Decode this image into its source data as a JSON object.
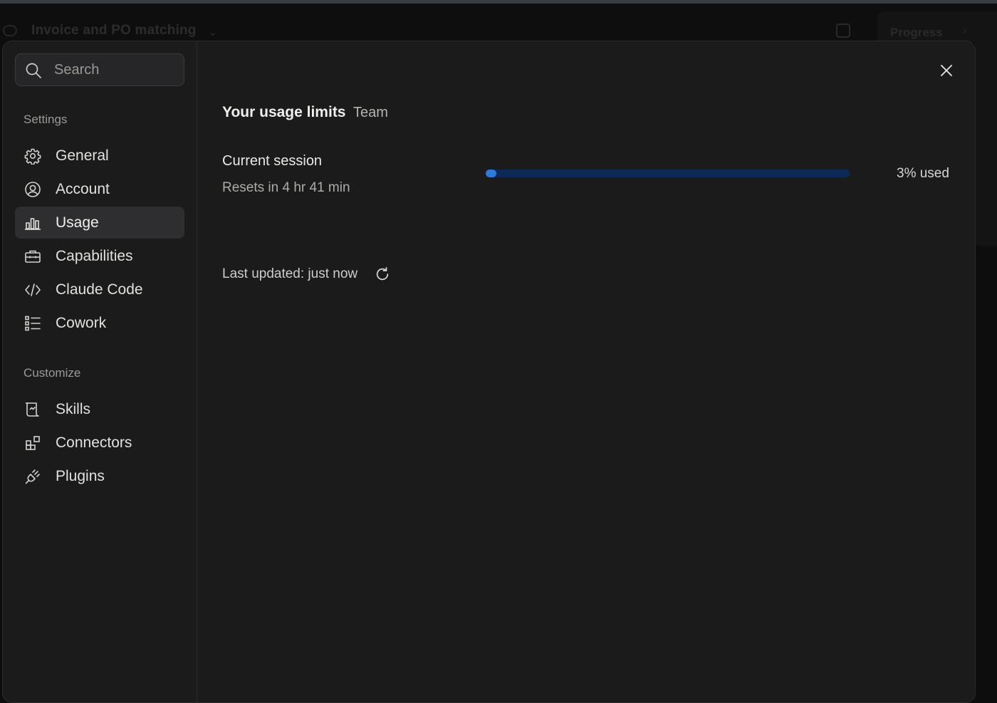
{
  "background": {
    "conversation_title": "Invoice and PO matching",
    "progress_label": "Progress"
  },
  "search": {
    "placeholder": "Search"
  },
  "sidebar": {
    "settings_label": "Settings",
    "settings_items": [
      {
        "label": "General",
        "icon": "gear-icon"
      },
      {
        "label": "Account",
        "icon": "user-circle-icon"
      },
      {
        "label": "Usage",
        "icon": "bar-chart-icon",
        "active": true
      },
      {
        "label": "Capabilities",
        "icon": "briefcase-icon"
      },
      {
        "label": "Claude Code",
        "icon": "code-icon"
      },
      {
        "label": "Cowork",
        "icon": "checklist-icon"
      }
    ],
    "customize_label": "Customize",
    "customize_items": [
      {
        "label": "Skills",
        "icon": "scroll-icon"
      },
      {
        "label": "Connectors",
        "icon": "blocks-icon"
      },
      {
        "label": "Plugins",
        "icon": "plug-icon"
      }
    ]
  },
  "usage": {
    "title": "Your usage limits",
    "plan": "Team",
    "session_label": "Current session",
    "session_reset": "Resets in 4 hr 41 min",
    "session_used_fraction": 0.03,
    "session_used_text": "3% used",
    "last_updated": "Last updated: just now"
  },
  "colors": {
    "accent": "#2f7bdc",
    "bar_track": "#0d2a57",
    "modal_bg": "#1b1b1c"
  }
}
